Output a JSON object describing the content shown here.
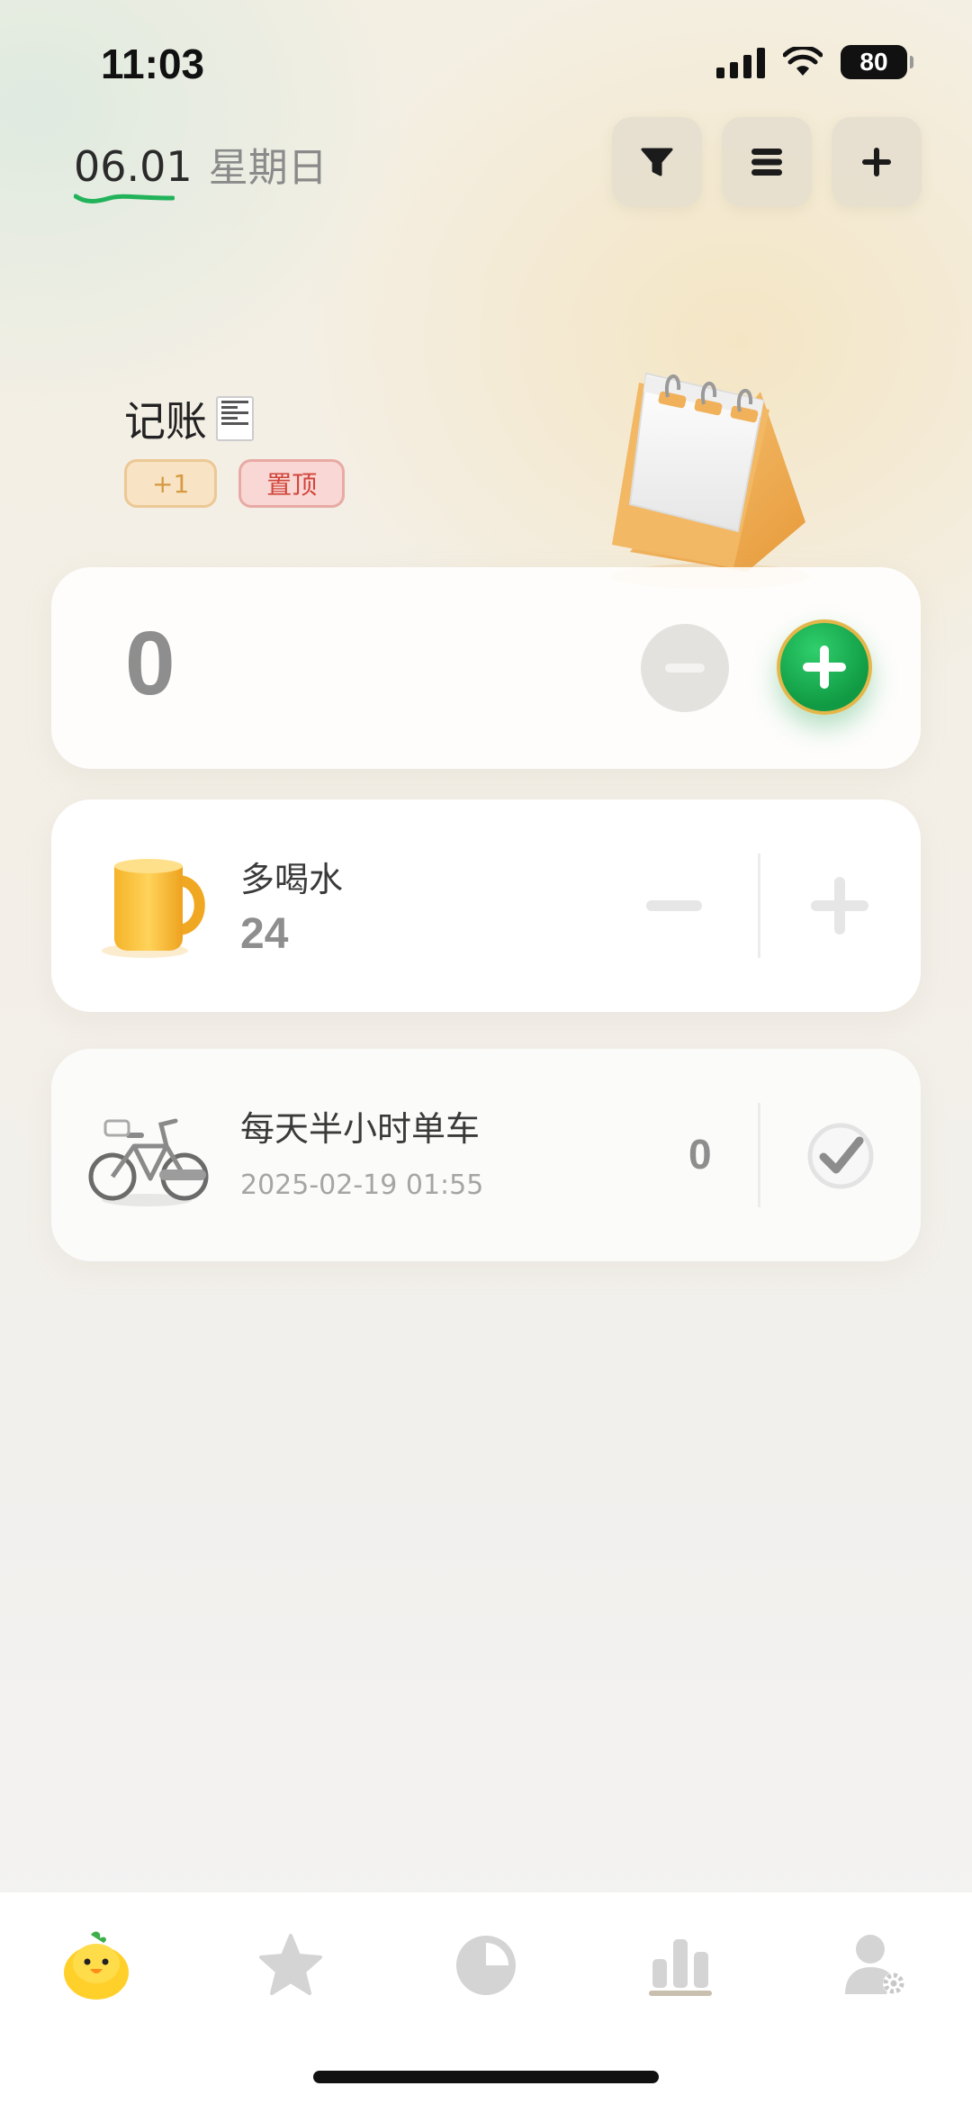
{
  "status_bar": {
    "time": "11:03",
    "battery": "80"
  },
  "header": {
    "date": "06.01",
    "weekday": "星期日",
    "actions": [
      {
        "icon": "filter-icon"
      },
      {
        "icon": "list-icon"
      },
      {
        "icon": "plus-icon"
      }
    ]
  },
  "ledger": {
    "title": "记账",
    "tags": {
      "plus_one": "+1",
      "pin": "置顶"
    },
    "count": "0"
  },
  "habits": [
    {
      "name": "多喝水",
      "count": "24",
      "icon": "mug-icon"
    },
    {
      "name": "每天半小时单车",
      "date": "2025-02-19 01:55",
      "value": "0",
      "icon": "bicycle-icon"
    }
  ],
  "bottom_nav": [
    {
      "icon": "duck-icon",
      "active": true
    },
    {
      "icon": "star-icon",
      "active": false
    },
    {
      "icon": "pie-chart-icon",
      "active": false
    },
    {
      "icon": "bar-chart-icon",
      "active": false
    },
    {
      "icon": "user-settings-icon",
      "active": false
    }
  ],
  "colors": {
    "accent_green": "#109a43",
    "pin_red": "#d2453b",
    "tag_orange": "#d69a42",
    "underline_green": "#22b35a"
  }
}
